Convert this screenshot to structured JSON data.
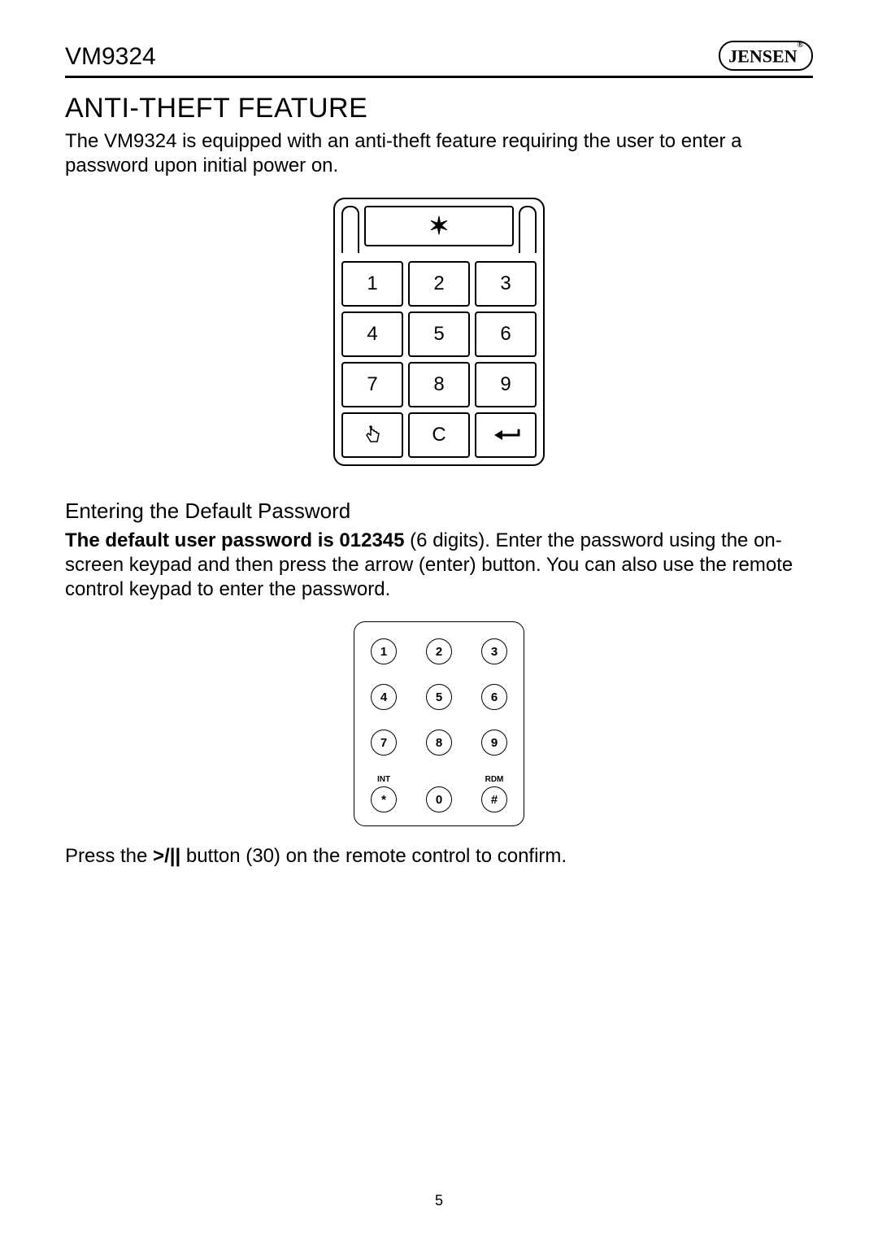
{
  "header": {
    "model": "VM9324",
    "brand": "JENSEN"
  },
  "section": {
    "title": "ANTI-THEFT FEATURE",
    "intro": "The VM9324 is equipped with an anti-theft feature requiring the user to enter a password upon initial power on."
  },
  "screen_keypad": {
    "display": "✶",
    "keys": [
      "1",
      "2",
      "3",
      "4",
      "5",
      "6",
      "7",
      "8",
      "9",
      "touch",
      "C",
      "enter"
    ]
  },
  "subsection": {
    "heading": "Entering the Default Password",
    "bold_lead": "The default user password is 012345",
    "rest": " (6 digits). Enter the password using the on-screen keypad and then press the arrow (enter) button. You can also use the remote control keypad to enter the password."
  },
  "remote_keypad": {
    "rows": [
      [
        {
          "label": "",
          "key": "1"
        },
        {
          "label": "",
          "key": "2"
        },
        {
          "label": "",
          "key": "3"
        }
      ],
      [
        {
          "label": "",
          "key": "4"
        },
        {
          "label": "",
          "key": "5"
        },
        {
          "label": "",
          "key": "6"
        }
      ],
      [
        {
          "label": "",
          "key": "7"
        },
        {
          "label": "",
          "key": "8"
        },
        {
          "label": "",
          "key": "9"
        }
      ],
      [
        {
          "label": "INT",
          "key": "*"
        },
        {
          "label": "",
          "key": "0"
        },
        {
          "label": "RDM",
          "key": "#"
        }
      ]
    ]
  },
  "confirm": {
    "pre": "Press the ",
    "btn": ">/||",
    "post": " button (30) on the remote control to confirm."
  },
  "page_number": "5"
}
